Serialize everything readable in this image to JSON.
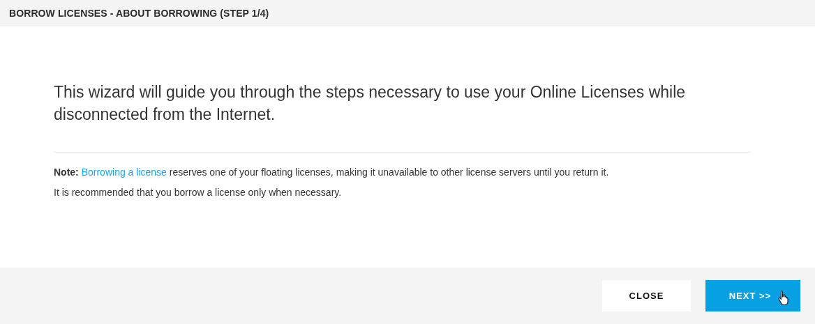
{
  "window": {
    "title": "BORROW LICENSES - ABOUT BORROWING (STEP 1/4)"
  },
  "intro": "This wizard will guide you through the steps necessary to use your Online Licenses while disconnected from the Internet.",
  "note": {
    "before": "**Note:**",
    "link": "Borrowing a license",
    "after": "reserves one of your floating licenses, making it unavailable to other license servers until you return it."
  },
  "recommendation": "It is recommended that you borrow a license only when necessary.",
  "buttons": [
    {
      "label": "CLOSE",
      "kind": "secondary"
    },
    {
      "label": "NEXT >>",
      "kind": "primary"
    }
  ]
}
